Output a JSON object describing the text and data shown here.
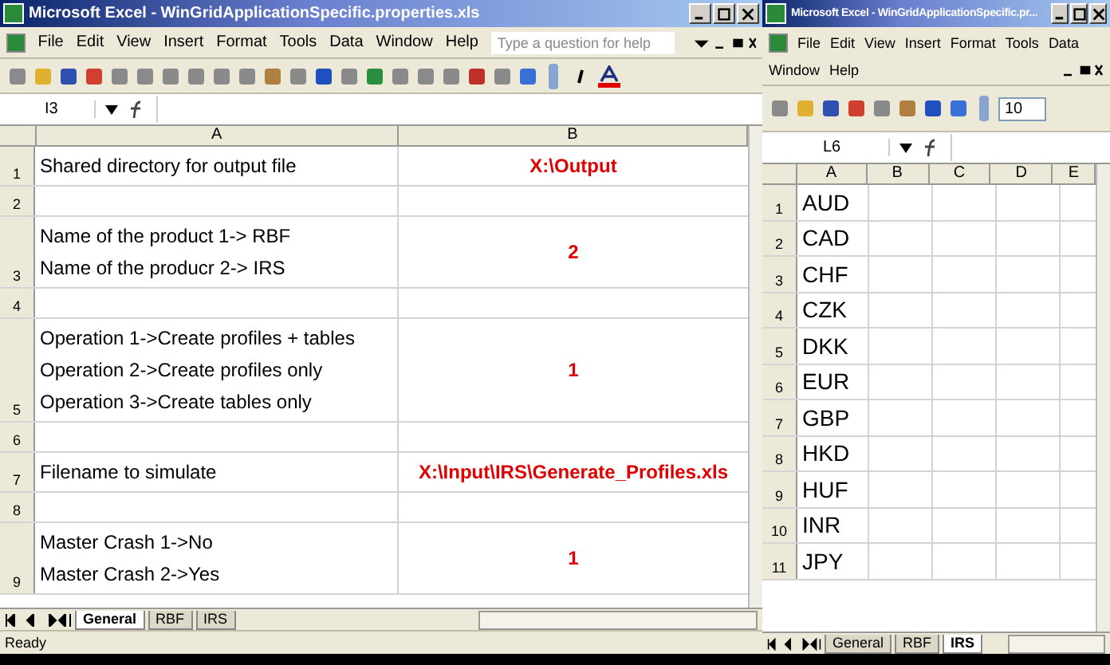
{
  "left_window": {
    "title": "Microsoft Excel - WinGridApplicationSpecific.properties.xls",
    "menu": [
      "File",
      "Edit",
      "View",
      "Insert",
      "Format",
      "Tools",
      "Data",
      "Window",
      "Help"
    ],
    "help_placeholder": "Type a question for help",
    "name_box": "I3",
    "columns": [
      "A",
      "B"
    ],
    "rows": [
      {
        "number": "1",
        "lines": [
          "Shared directory for output file"
        ],
        "value": "X:\\Output"
      },
      {
        "number": "2",
        "lines": [],
        "value": ""
      },
      {
        "number": "3",
        "lines": [
          "Name of the product 1-> RBF",
          "Name of the producr 2-> IRS"
        ],
        "value": "2"
      },
      {
        "number": "4",
        "lines": [],
        "value": ""
      },
      {
        "number": "5",
        "lines": [
          "Operation 1->Create profiles + tables",
          "Operation 2->Create profiles only",
          "Operation 3->Create tables only"
        ],
        "value": "1"
      },
      {
        "number": "6",
        "lines": [],
        "value": ""
      },
      {
        "number": "7",
        "lines": [
          "Filename to simulate"
        ],
        "value": "X:\\Input\\IRS\\Generate_Profiles.xls"
      },
      {
        "number": "8",
        "lines": [],
        "value": ""
      },
      {
        "number": "9",
        "lines": [
          "Master Crash 1->No",
          "Master Crash 2->Yes"
        ],
        "value": "1"
      }
    ],
    "sheet_tabs": [
      {
        "label": "General",
        "selected": true
      },
      {
        "label": "RBF",
        "selected": false
      },
      {
        "label": "IRS",
        "selected": false
      }
    ],
    "status": "Ready"
  },
  "right_window": {
    "title": "Microsoft Excel - WinGridApplicationSpecific.pr...",
    "menu": [
      "File",
      "Edit",
      "View",
      "Insert",
      "Format",
      "Tools",
      "Data",
      "Window",
      "Help"
    ],
    "font_size": "10",
    "name_box": "L6",
    "columns": [
      "A",
      "B",
      "C",
      "D",
      "E"
    ],
    "rows": [
      {
        "number": "1",
        "value": "AUD"
      },
      {
        "number": "2",
        "value": "CAD"
      },
      {
        "number": "3",
        "value": "CHF"
      },
      {
        "number": "4",
        "value": "CZK"
      },
      {
        "number": "5",
        "value": "DKK"
      },
      {
        "number": "6",
        "value": "EUR"
      },
      {
        "number": "7",
        "value": "GBP"
      },
      {
        "number": "8",
        "value": "HKD"
      },
      {
        "number": "9",
        "value": "HUF"
      },
      {
        "number": "10",
        "value": "INR"
      },
      {
        "number": "11",
        "value": "JPY"
      }
    ],
    "sheet_tabs": [
      {
        "label": "General",
        "selected": false
      },
      {
        "label": "RBF",
        "selected": false
      },
      {
        "label": "IRS",
        "selected": true
      }
    ]
  }
}
